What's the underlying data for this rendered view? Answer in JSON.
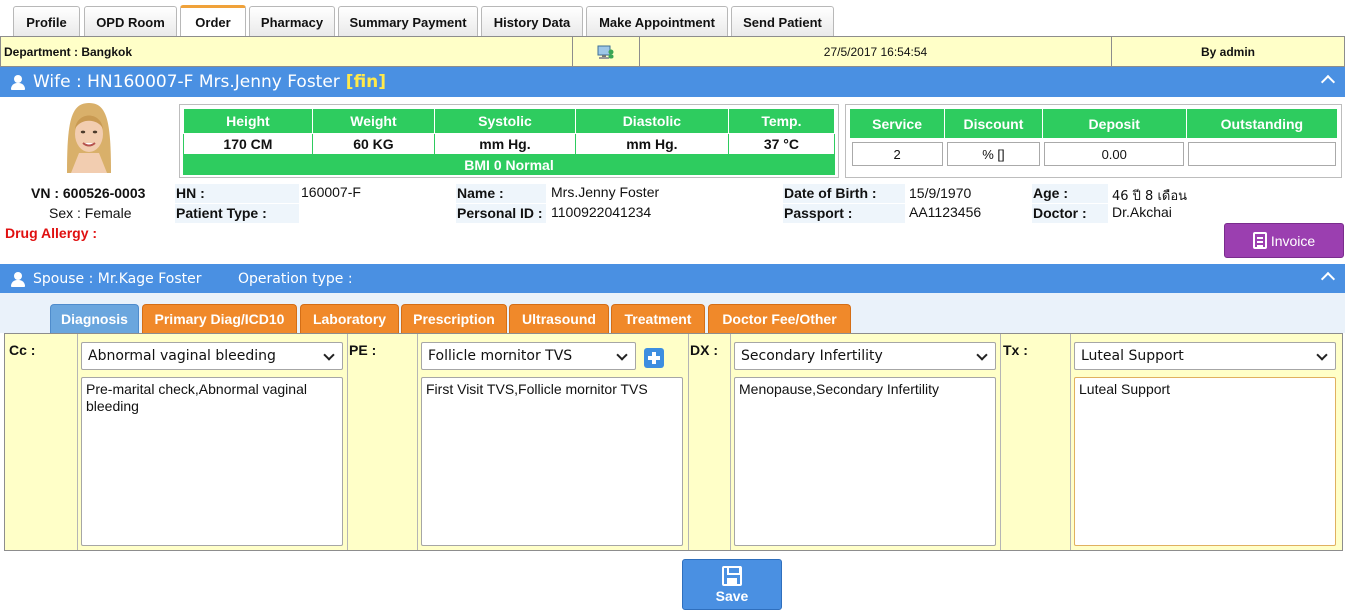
{
  "top_tabs": [
    "Profile",
    "OPD Room",
    "Order",
    "Pharmacy",
    "Summary Payment",
    "History Data",
    "Make Appointment",
    "Send Patient"
  ],
  "department": {
    "label": "Department : Bangkok",
    "datetime": "27/5/2017 16:54:54",
    "user": "By admin"
  },
  "wife_header": {
    "title": "Wife : HN160007-F Mrs.Jenny Foster",
    "status": "[fin]"
  },
  "vitals": {
    "headers": [
      "Height",
      "Weight",
      "Systolic",
      "Diastolic",
      "Temp."
    ],
    "values": [
      "170 CM",
      "60 KG",
      "mm Hg.",
      "mm Hg.",
      "37 °C"
    ],
    "bmi": "BMI 0   Normal"
  },
  "finance": {
    "headers": [
      "Service",
      "Discount",
      "Deposit",
      "Outstanding"
    ],
    "values": [
      "2",
      "% []",
      "0.00",
      ""
    ]
  },
  "patient": {
    "vn": "VN : 600526-0003",
    "sex": "Sex : Female",
    "drug_allergy": "Drug Allergy :",
    "hn_label": "HN :",
    "hn": "160007-F",
    "patient_type_label": "Patient Type :",
    "name_label": "Name :",
    "name": "Mrs.Jenny Foster",
    "personal_id_label": "Personal ID :",
    "personal_id": "1100922041234",
    "dob_label": "Date of Birth :",
    "dob": "15/9/1970",
    "passport_label": "Passport :",
    "passport": "AA1123456",
    "age_label": "Age :",
    "age": "46 ปี 8 เดือน",
    "doctor_label": "Doctor :",
    "doctor": "Dr.Akchai"
  },
  "invoice_label": "Invoice",
  "spouse_bar": {
    "spouse": "Spouse : Mr.Kage Foster",
    "operation": "Operation type :"
  },
  "sub_tabs": [
    "Diagnosis",
    "Primary Diag/ICD10",
    "Laboratory",
    "Prescription",
    "Ultrasound",
    "Treatment",
    "Doctor Fee/Other"
  ],
  "diagnosis": {
    "cc": {
      "label": "Cc :",
      "selected": "Abnormal vaginal bleeding",
      "text": "Pre-marital check,Abnormal vaginal bleeding"
    },
    "pe": {
      "label": "PE :",
      "selected": "Follicle mornitor TVS",
      "text": "First Visit TVS,Follicle mornitor TVS"
    },
    "dx": {
      "label": "DX :",
      "selected": "Secondary Infertility",
      "text": "Menopause,Secondary Infertility"
    },
    "tx": {
      "label": "Tx :",
      "selected": "Luteal Support",
      "text": "Luteal Support"
    }
  },
  "save_label": "Save",
  "colors": {
    "header_blue": "#4a90e2",
    "tab_orange": "#f0892a",
    "vitals_green": "#2ecc5f",
    "invoice_purple": "#9b3fb0",
    "panel_yellow": "#ffffc8"
  }
}
